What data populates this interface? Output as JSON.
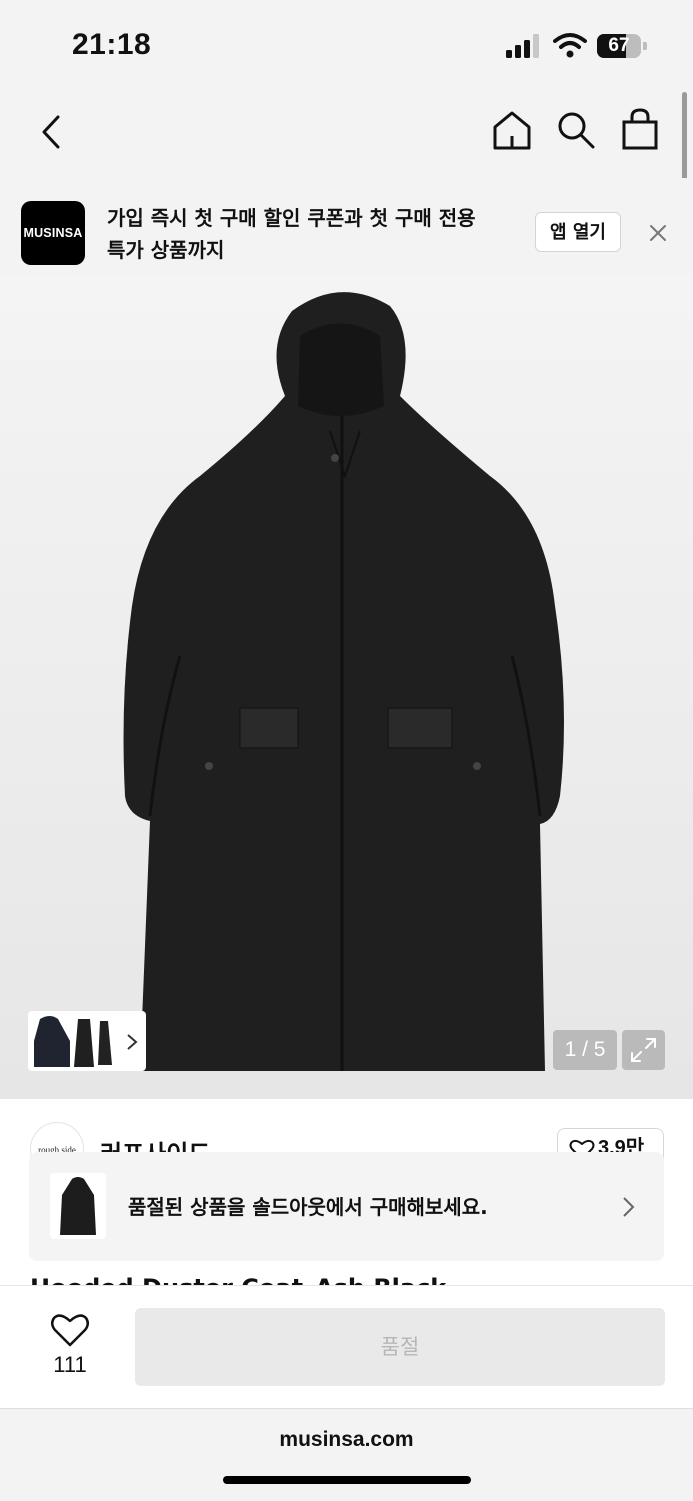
{
  "status_bar": {
    "time": "21:18",
    "battery": "67",
    "battery_level": 0.67
  },
  "nav": {
    "icons": [
      "back-icon",
      "home-icon",
      "search-icon",
      "shopping-bag-icon"
    ]
  },
  "promo": {
    "logo_text": "MUSINSA",
    "line1": "가입 즉시 첫 구매 할인 쿠폰과 첫 구매 전용",
    "line2": "특가 상품까지",
    "open_app_label": "앱 열기",
    "close_icon": "close-icon"
  },
  "gallery": {
    "counter": "1 / 5",
    "expand_icon": "expand-icon",
    "thumb_chevron": "chevron-right-icon"
  },
  "store": {
    "logo_text": "rough side",
    "name": "러프사이드",
    "likes": "3.9만"
  },
  "soldout_banner": {
    "text": "품절된 상품을 솔드아웃에서 구매해보세요."
  },
  "product": {
    "title_peek": "Hooded Duster Coat_Ash Black"
  },
  "action_bar": {
    "wish_count": "111",
    "button_label": "품절"
  },
  "browser": {
    "url": "musinsa.com"
  },
  "colors": {
    "background": "#f3f3f3",
    "coat": "#1f1f1f",
    "button_disabled": "#e9e9e9"
  }
}
